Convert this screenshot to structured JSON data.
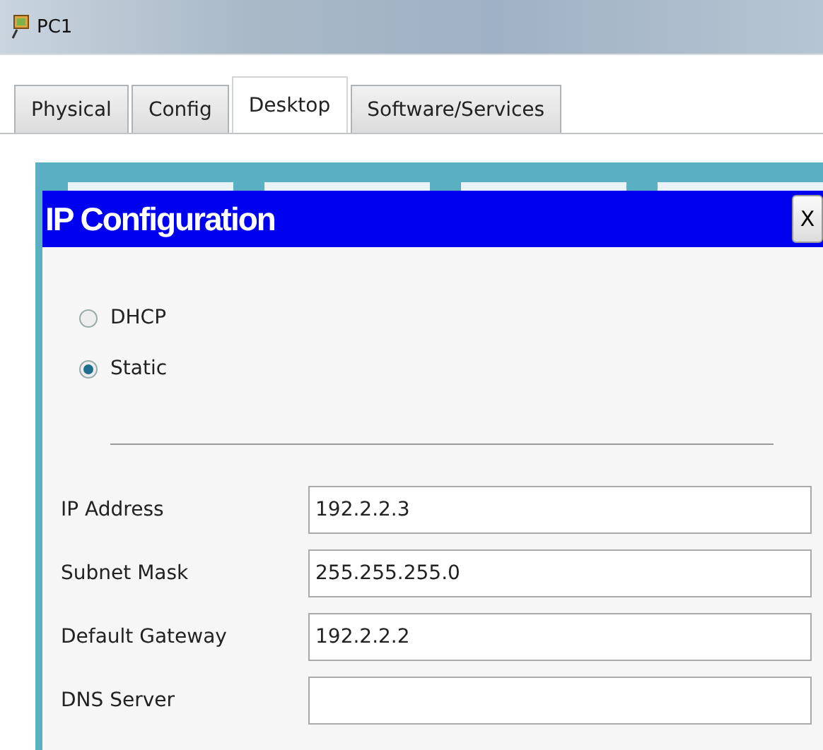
{
  "window": {
    "title": "PC1"
  },
  "tabs": [
    {
      "label": "Physical",
      "selected": false
    },
    {
      "label": "Config",
      "selected": false
    },
    {
      "label": "Desktop",
      "selected": true
    },
    {
      "label": "Software/Services",
      "selected": false
    }
  ],
  "dialog": {
    "title": "IP Configuration",
    "close": "X",
    "modes": [
      {
        "label": "DHCP",
        "selected": false
      },
      {
        "label": "Static",
        "selected": true
      }
    ],
    "fields": [
      {
        "label": "IP Address",
        "value": "192.2.2.3"
      },
      {
        "label": "Subnet Mask",
        "value": "255.255.255.0"
      },
      {
        "label": "Default Gateway",
        "value": "192.2.2.2"
      },
      {
        "label": "DNS Server"
      }
    ]
  }
}
